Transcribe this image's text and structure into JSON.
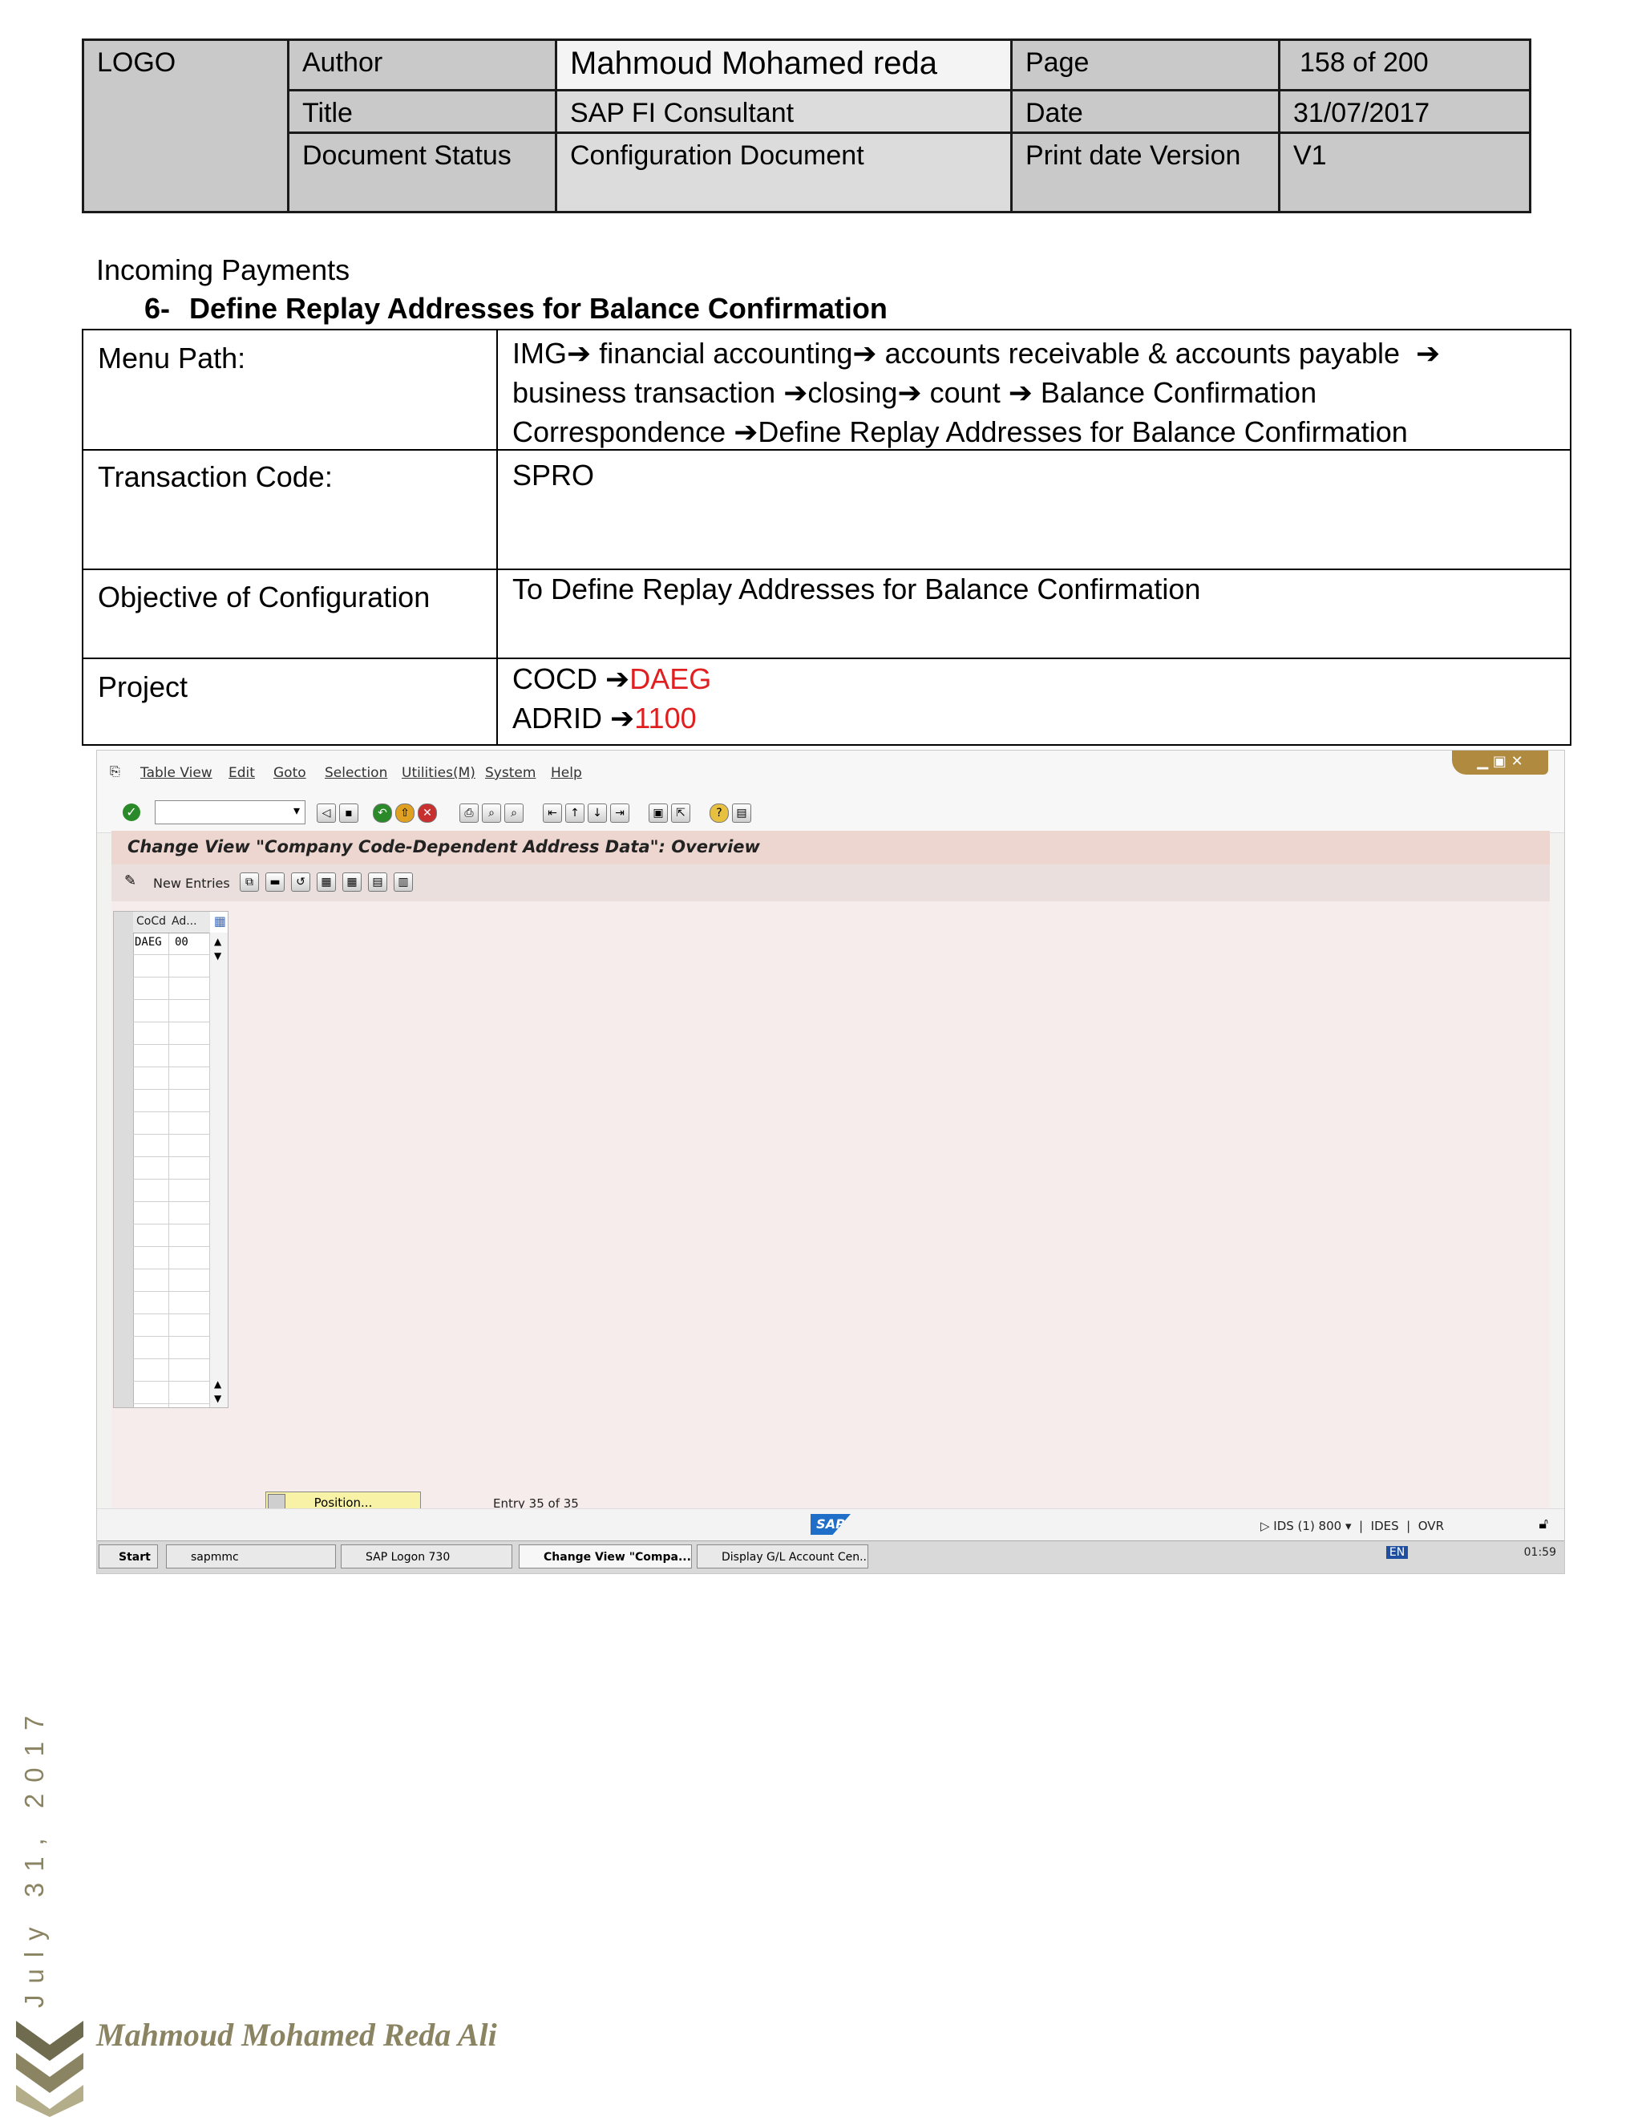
{
  "header": {
    "logo": "LOGO",
    "author_label": "Author",
    "author_value": "Mahmoud Mohamed reda",
    "page_label": "Page",
    "page_value": "158 of 200",
    "title_label": "Title",
    "title_value": "SAP FI Consultant",
    "date_label": "Date",
    "date_value": "31/07/2017",
    "status_label": "Document Status",
    "status_value": "Configuration Document",
    "print_label": "Print date Version",
    "print_value": "V1"
  },
  "section": {
    "parent": "Incoming Payments",
    "number": "6-",
    "heading": "Define Replay Addresses for Balance Confirmation"
  },
  "config": {
    "menu_label": "Menu Path:",
    "menu_parts": [
      "IMG",
      "financial accounting",
      "accounts receivable & accounts payable",
      "business transaction",
      "closing",
      "count",
      "Balance Confirmation Correspondence",
      "Define Replay Addresses for Balance Confirmation"
    ],
    "tcode_label": "Transaction Code:",
    "tcode_value": "SPRO",
    "objective_label": "Objective of Configuration",
    "objective_value": "To Define Replay Addresses for Balance Confirmation",
    "project_label": "Project",
    "project_lines": [
      {
        "key": "COCD",
        "value": "DAEG"
      },
      {
        "key": "ADRID",
        "value": "1100"
      }
    ],
    "arrow": "➔"
  },
  "sap": {
    "menu": [
      "Table View",
      "Edit",
      "Goto",
      "Selection",
      "Utilities(M)",
      "System",
      "Help"
    ],
    "screen_title": "Change View \"Company Code-Dependent Address Data\": Overview",
    "new_entries": "New Entries",
    "columns": [
      "CoCd",
      "Ad..."
    ],
    "row": {
      "cocd": "DAEG",
      "adrid": "00"
    },
    "position_button": "Position...",
    "entry_info": "Entry 35 of 35",
    "sap_logo": "SAP",
    "system_info": "IDS (1) 800",
    "client_host": "IDES",
    "mode": "OVR",
    "taskbar": [
      "Start",
      "sapmmc",
      "SAP Logon 730",
      "Change View \"Compa...",
      "Display G/L Account Cen..."
    ],
    "lang": "EN",
    "clock": "01:59"
  },
  "footer": {
    "side_date": "July 31, 2017",
    "signature": "Mahmoud Mohamed Reda Ali"
  },
  "colors": {
    "highlight_red": "#e02020",
    "accent_olive": "#8a8462",
    "header_grey": "#c9c9c9"
  }
}
